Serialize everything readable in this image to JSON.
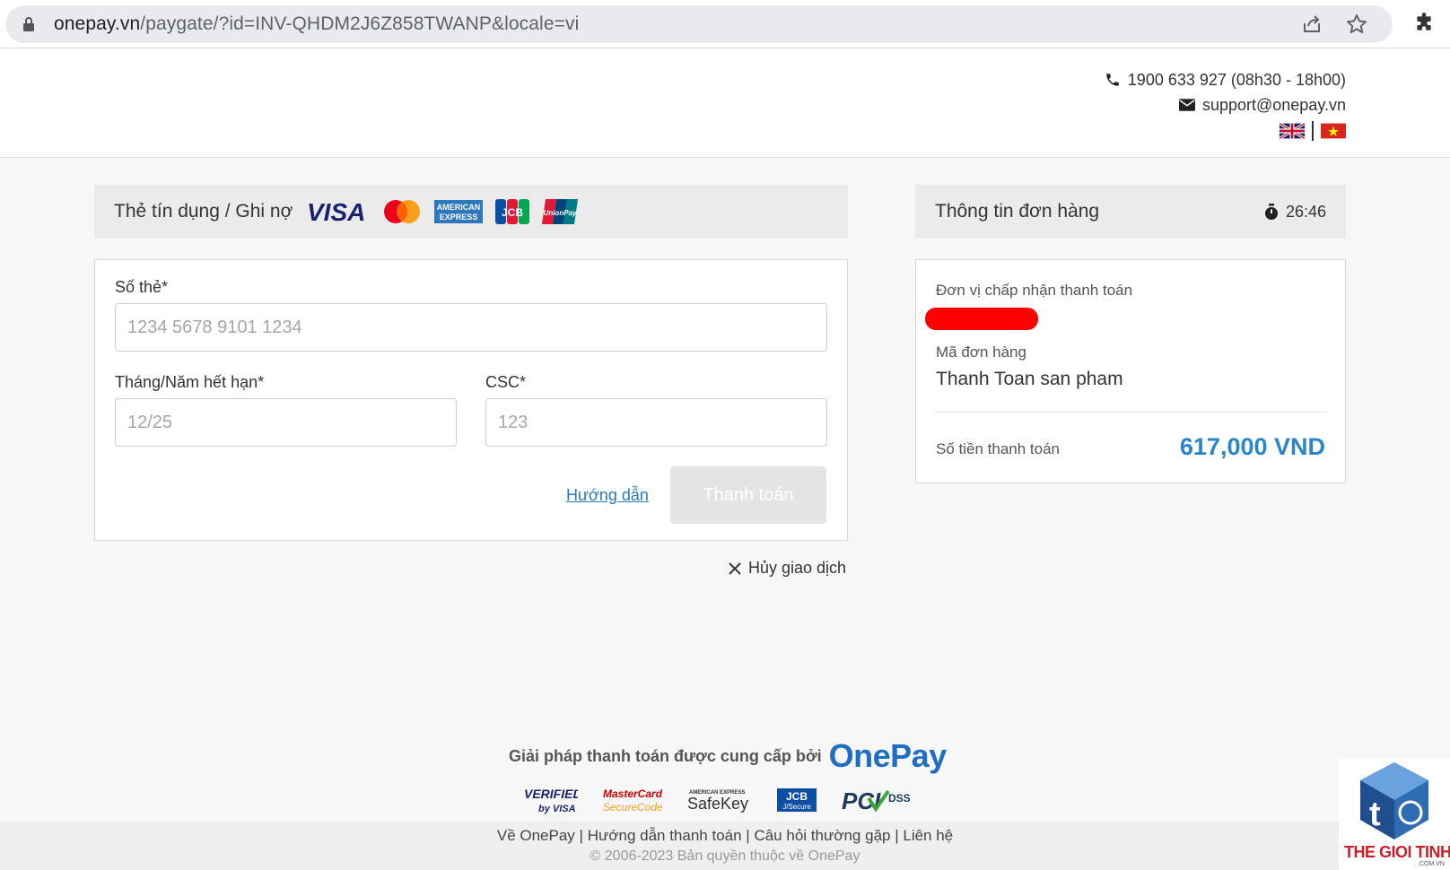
{
  "browser": {
    "url_host": "onepay.vn",
    "url_path": "/paygate/?id=INV-QHDM2J6Z858TWANP&locale=vi"
  },
  "header": {
    "phone": "1900 633 927 (08h30 - 18h00)",
    "email": "support@onepay.vn"
  },
  "card_panel": {
    "title": "Thẻ tín dụng / Ghi nợ",
    "brands": [
      "VISA",
      "Mastercard",
      "American Express",
      "JCB",
      "UnionPay"
    ],
    "card_number_label": "Số thẻ*",
    "card_number_placeholder": "1234 5678 9101 1234",
    "expiry_label": "Tháng/Năm hết hạn*",
    "expiry_placeholder": "12/25",
    "csc_label": "CSC*",
    "csc_placeholder": "123",
    "guide_link": "Hướng dẫn",
    "pay_button": "Thanh toán",
    "cancel": "Hủy giao dịch"
  },
  "order": {
    "title": "Thông tin đơn hàng",
    "timer": "26:46",
    "merchant_label": "Đơn vị chấp nhận thanh toán",
    "order_id_label": "Mã đơn hàng",
    "order_id_value": "Thanh Toan san pham",
    "amount_label": "Số tiền thanh toán",
    "amount_value": "617,000 VND"
  },
  "footer": {
    "provided_by": "Giải pháp thanh toán được cung cấp bởi",
    "brand": "OnePay",
    "badges": [
      "Verified by VISA",
      "MasterCard SecureCode",
      "American Express SafeKey",
      "JCB J/Secure",
      "PCI DSS"
    ],
    "links": [
      "Về OnePay",
      "Hướng dẫn thanh toán",
      "Câu hỏi thường gặp",
      "Liên hệ"
    ],
    "copyright": "© 2006-2023 Bản quyền thuộc về OnePay"
  },
  "watermark": {
    "text": "THE GIOI TINHOC",
    "sub": ".COM.VN"
  },
  "colors": {
    "accent": "#2a86c8",
    "link": "#2a7ab8",
    "redaction": "#ff0000"
  }
}
